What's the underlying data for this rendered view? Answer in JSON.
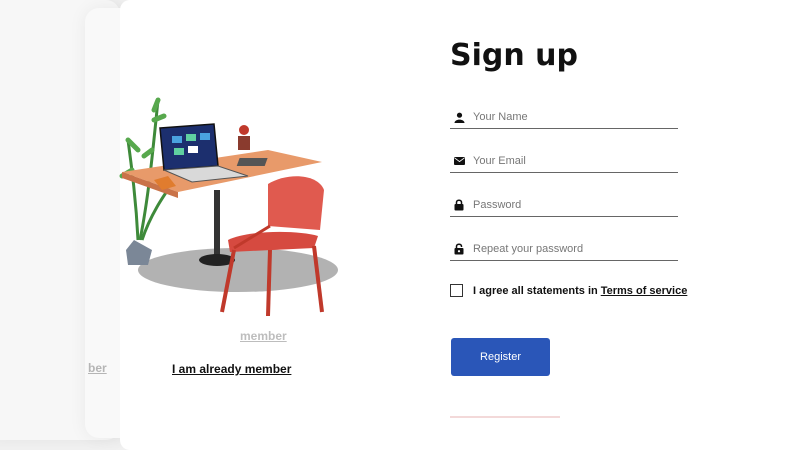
{
  "signup": {
    "title": "Sign up",
    "fields": {
      "name": {
        "placeholder": "Your Name",
        "icon": "user-icon"
      },
      "email": {
        "placeholder": "Your Email",
        "icon": "envelope-icon"
      },
      "password": {
        "placeholder": "Password",
        "icon": "lock-icon"
      },
      "repeat_password": {
        "placeholder": "Repeat your password",
        "icon": "lock-open-icon"
      }
    },
    "agree_text": "I agree all statements in",
    "terms_link": "Terms of service",
    "register_label": "Register"
  },
  "member_link": "I am already member",
  "ghost_links": {
    "left": "ber",
    "mid": "member"
  },
  "colors": {
    "accent": "#2a56b8",
    "text": "#111111",
    "chair": "#e05a4f",
    "desk": "#e89a6a"
  }
}
